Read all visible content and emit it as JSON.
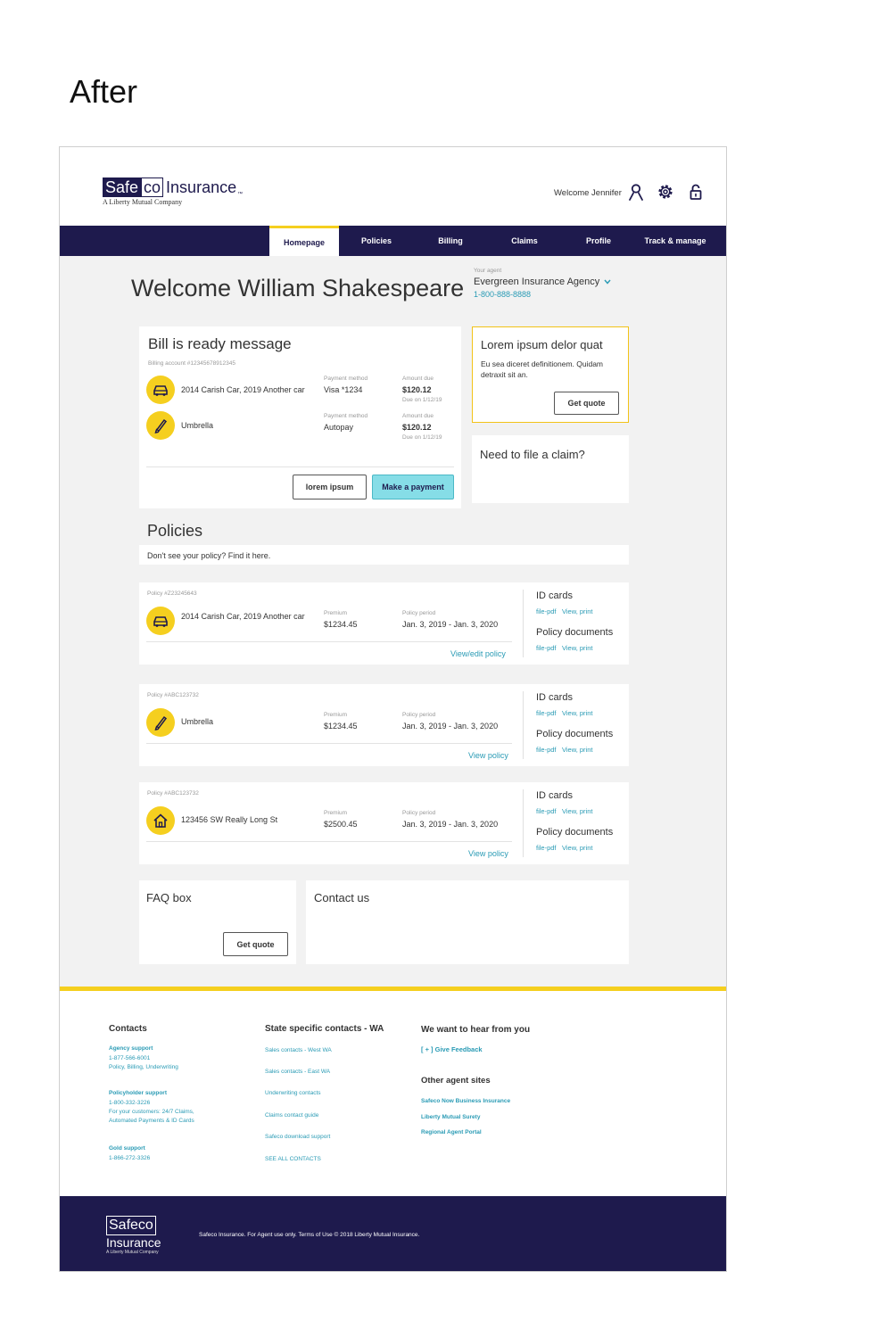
{
  "page_heading": "After",
  "header": {
    "logo_safe": "Safe",
    "logo_co": "co",
    "logo_insurance": "Insurance",
    "logo_tm": "™",
    "logo_sub": "A Liberty Mutual Company",
    "welcome": "Welcome Jennifer"
  },
  "nav": {
    "tabs": [
      {
        "label": "Homepage"
      },
      {
        "label": "Policies"
      },
      {
        "label": "Billing"
      },
      {
        "label": "Claims"
      },
      {
        "label": "Profile"
      },
      {
        "label": "Track & manage"
      }
    ]
  },
  "main": {
    "welcome_title": "Welcome William Shakespeare",
    "agent": {
      "label": "Your agent",
      "name": "Evergreen Insurance Agency",
      "phone": "1-800-888-8888"
    }
  },
  "bill": {
    "title": "Bill is ready message",
    "account": "Billing account #12345678912345",
    "items": [
      {
        "name": "2014 Carish Car, 2019 Another car",
        "method_label": "Payment method",
        "method": "Visa *1234",
        "amount_label": "Amount due",
        "amount": "$120.12",
        "due": "Due on 1/12/19"
      },
      {
        "name": "Umbrella",
        "method_label": "Payment method",
        "method": "Autopay",
        "amount_label": "Amount due",
        "amount": "$120.12",
        "due": "Due on 1/12/19"
      }
    ],
    "secondary_button": "lorem ipsum",
    "primary_button": "Make a payment"
  },
  "quote": {
    "title": "Lorem ipsum delor quat",
    "text": "Eu sea diceret definitionem. Quidam detraxit sit an.",
    "button": "Get quote"
  },
  "claim": {
    "title": "Need to file a claim?"
  },
  "policies": {
    "title": "Policies",
    "notice": "Don't see your policy? Find it here.",
    "items": [
      {
        "number": "Policy #Z23245643",
        "name": "2014 Carish Car, 2019 Another car",
        "premium_label": "Premium",
        "premium": "$1234.45",
        "period_label": "Policy period",
        "period": "Jan. 3, 2019 - Jan. 3, 2020",
        "action": "View/edit policy",
        "id_cards": "ID cards",
        "docs": "Policy documents",
        "file": "file-pdf",
        "view": "View, print"
      },
      {
        "number": "Policy #ABC123732",
        "name": "Umbrella",
        "premium_label": "Premium",
        "premium": "$1234.45",
        "period_label": "Policy period",
        "period": "Jan. 3, 2019 - Jan. 3, 2020",
        "action": "View policy",
        "id_cards": "ID cards",
        "docs": "Policy documents",
        "file": "file-pdf",
        "view": "View, print"
      },
      {
        "number": "Policy #ABC123732",
        "name": "123456 SW Really Long St",
        "premium_label": "Premium",
        "premium": "$2500.45",
        "period_label": "Policy period",
        "period": "Jan. 3, 2019 - Jan. 3, 2020",
        "action": "View policy",
        "id_cards": "ID cards",
        "docs": "Policy documents",
        "file": "file-pdf",
        "view": "View, print"
      }
    ]
  },
  "faq": {
    "title": "FAQ box",
    "button": "Get quote"
  },
  "contact": {
    "title": "Contact us"
  },
  "footer": {
    "contacts": {
      "heading": "Contacts",
      "agency_label": "Agency support",
      "agency_text1": "1-877-566-6001",
      "agency_text2": "Policy, Billing, Underwriting",
      "policyholder_label": "Policyholder support",
      "policyholder_text1": "1-800-332-3226",
      "policyholder_text2": "For your customers: 24/7 Claims,",
      "policyholder_text3": "Automated Payments & ID Cards",
      "gold_label": "Gold support",
      "gold_text": "1-866-272-3326"
    },
    "state": {
      "heading": "State specific contacts - WA",
      "links": [
        "Sales contacts - West WA",
        "Sales contacts - East WA",
        "Underwriting contacts",
        "Claims contact guide",
        "Safeco download support",
        "SEE ALL CONTACTS"
      ]
    },
    "feedback": {
      "heading": "We want to hear from you",
      "link": "[ + ] Give Feedback",
      "other_heading": "Other agent sites",
      "sites": [
        "Safeco Now Business Insurance",
        "Liberty Mutual Surety",
        "Regional Agent Portal"
      ]
    }
  },
  "bottom": {
    "logo_safe": "Safeco",
    "logo_insurance": "Insurance",
    "logo_sub": "A Liberty Mutual Company",
    "text": "Safeco Insurance. For Agent use only.  Terms of Use  © 2018  Liberty Mutual Insurance."
  },
  "colors": {
    "navy": "#1e1a4d",
    "accent_yellow": "#f5cf1f",
    "link_teal": "#2a9bb5",
    "primary_button": "#86dde7"
  }
}
